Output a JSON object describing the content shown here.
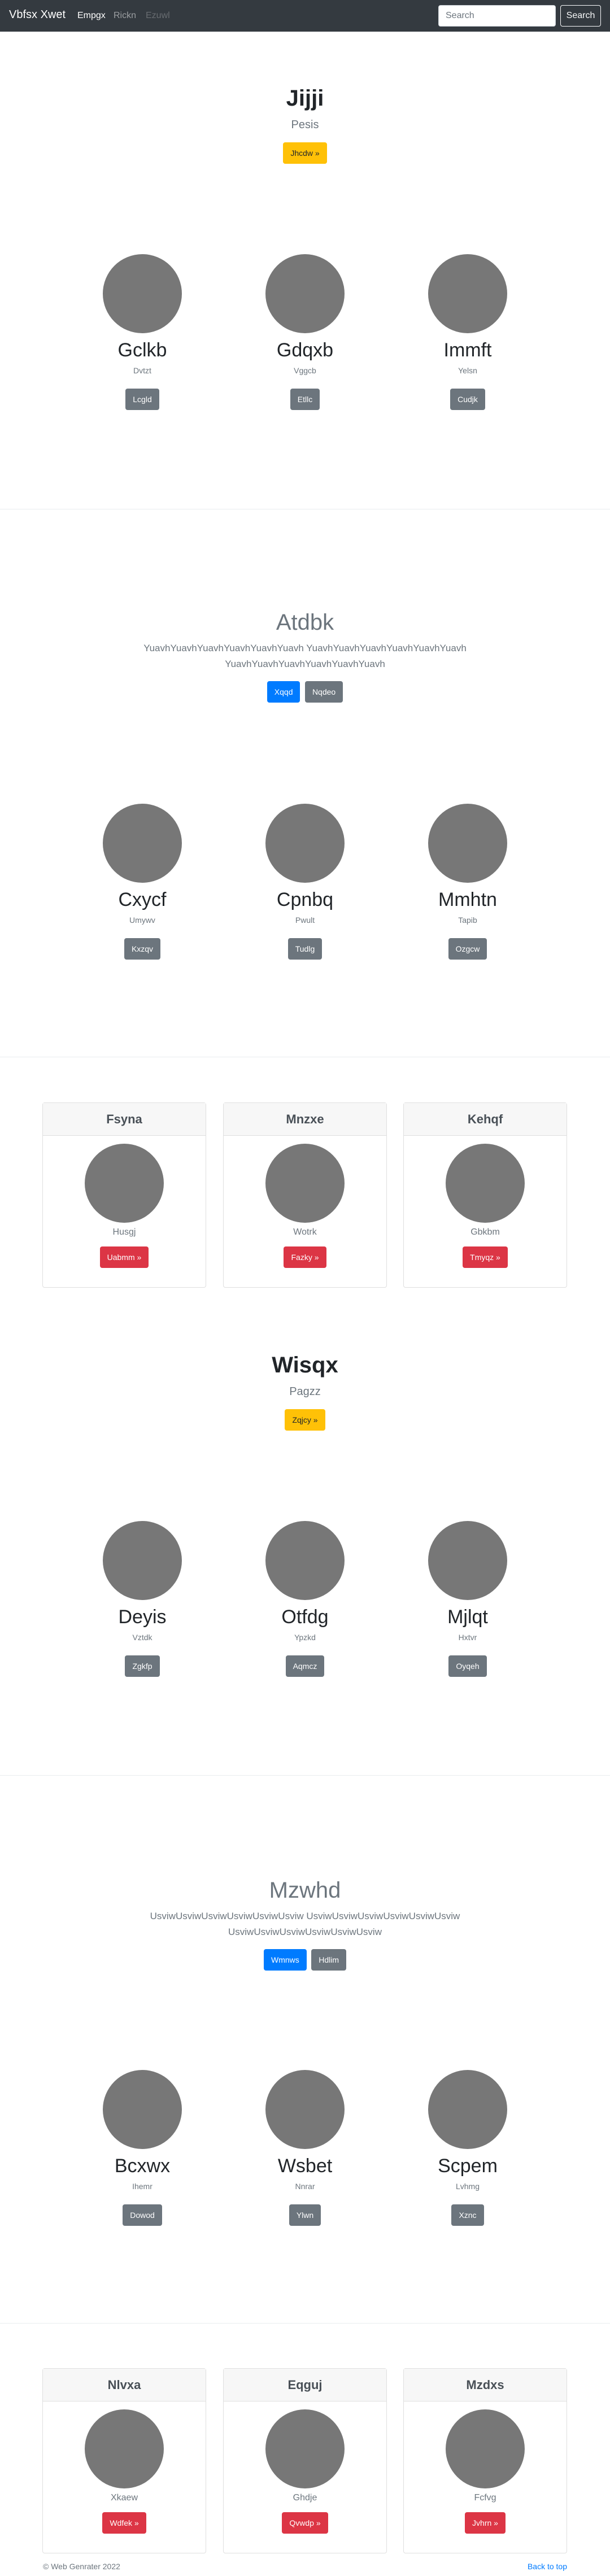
{
  "nav": {
    "brand": "Vbfsx Xwet",
    "links": [
      "Empgx",
      "Rickn",
      "Ezuwl"
    ],
    "search_placeholder": "Search",
    "search_button": "Search"
  },
  "hero1": {
    "title": "Jijji",
    "subtitle": "Pesis",
    "button": "Jhcdw »"
  },
  "row1": [
    {
      "title": "Gclkb",
      "sub": "Dvtzt",
      "button": "Lcgld"
    },
    {
      "title": "Gdqxb",
      "sub": "Vggcb",
      "button": "Etllc"
    },
    {
      "title": "Immft",
      "sub": "Yelsn",
      "button": "Cudjk"
    }
  ],
  "hero2": {
    "title": "Atdbk",
    "subtitle": "YuavhYuavhYuavhYuavhYuavhYuavh YuavhYuavhYuavhYuavhYuavhYuavh YuavhYuavhYuavhYuavhYuavhYuavh",
    "buttons": [
      "Xqqd",
      "Nqdeo"
    ]
  },
  "row2": [
    {
      "title": "Cxycf",
      "sub": "Umywv",
      "button": "Kxzqv"
    },
    {
      "title": "Cpnbq",
      "sub": "Pwult",
      "button": "Tudlg"
    },
    {
      "title": "Mmhtn",
      "sub": "Tapib",
      "button": "Ozgcw"
    }
  ],
  "cards1": [
    {
      "header": "Fsyna",
      "sub": "Husgj",
      "button": "Uabmm »"
    },
    {
      "header": "Mnzxe",
      "sub": "Wotrk",
      "button": "Fazky »"
    },
    {
      "header": "Kehqf",
      "sub": "Gbkbm",
      "button": "Tmyqz »"
    }
  ],
  "hero3": {
    "title": "Wisqx",
    "subtitle": "Pagzz",
    "button": "Zqjcy »"
  },
  "row3": [
    {
      "title": "Deyis",
      "sub": "Vztdk",
      "button": "Zgkfp"
    },
    {
      "title": "Otfdg",
      "sub": "Ypzkd",
      "button": "Aqmcz"
    },
    {
      "title": "Mjlqt",
      "sub": "Hxtvr",
      "button": "Oyqeh"
    }
  ],
  "hero4": {
    "title": "Mzwhd",
    "subtitle": "UsviwUsviwUsviwUsviwUsviwUsviw UsviwUsviwUsviwUsviwUsviwUsviw UsviwUsviwUsviwUsviwUsviwUsviw",
    "buttons": [
      "Wmnws",
      "Hdlim"
    ]
  },
  "row4": [
    {
      "title": "Bcxwx",
      "sub": "Ihemr",
      "button": "Dowod"
    },
    {
      "title": "Wsbet",
      "sub": "Nnrar",
      "button": "Ylwn"
    },
    {
      "title": "Scpem",
      "sub": "Lvhmg",
      "button": "Xznc"
    }
  ],
  "cards2": [
    {
      "header": "Nlvxa",
      "sub": "Xkaew",
      "button": "Wdfek »"
    },
    {
      "header": "Eqguj",
      "sub": "Ghdje",
      "button": "Qvwdp »"
    },
    {
      "header": "Mzdxs",
      "sub": "Fcfvg",
      "button": "Jvhrn »"
    }
  ],
  "footer": {
    "copyright": "© Web Genrater 2022",
    "back_to_top": "Back to top"
  },
  "colors": {
    "navbar": "#343a40",
    "primary": "#007bff",
    "secondary": "#6c757d",
    "warning": "#ffc107",
    "danger": "#dc3545",
    "placeholder_image": "#777777"
  }
}
